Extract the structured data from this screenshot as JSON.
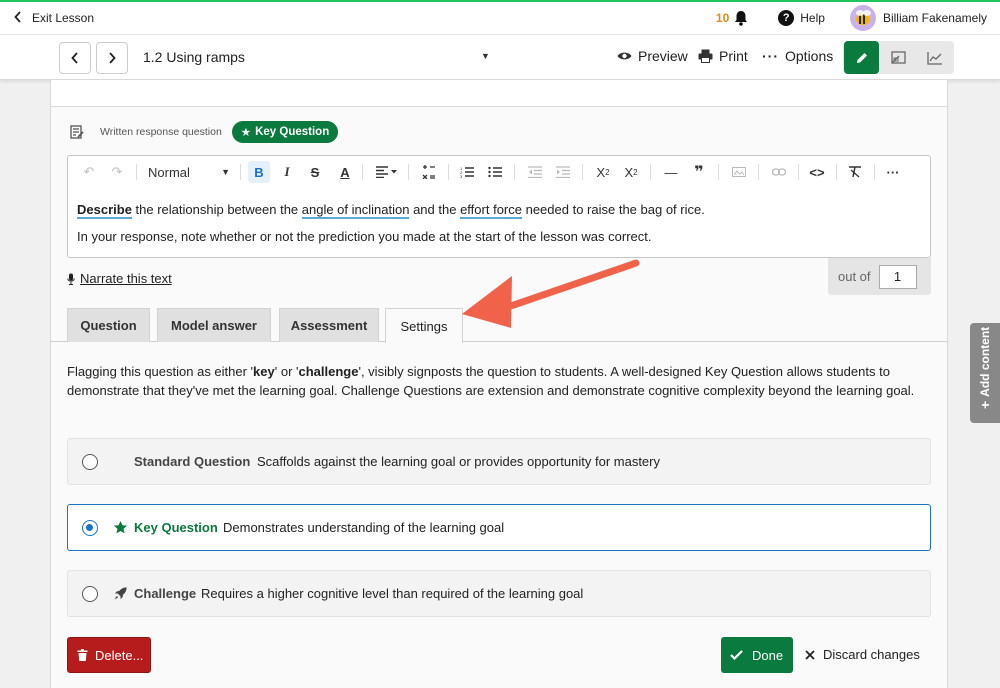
{
  "topbar": {
    "exit_label": "Exit Lesson",
    "notification_count": "10",
    "help_label": "Help",
    "user_name": "Billiam Fakenamely"
  },
  "lessonbar": {
    "title": "1.2 Using ramps",
    "preview_label": "Preview",
    "print_label": "Print",
    "options_label": "Options"
  },
  "question": {
    "type_label": "Written response question",
    "badge_label": "Key Question",
    "toolbar": {
      "style_select": "Normal"
    },
    "body": {
      "line1_kw1": "Describe",
      "line1_t1": " the relationship between the ",
      "line1_kw2": "angle of inclination",
      "line1_t2": " and the ",
      "line1_kw3": "effort force",
      "line1_t3": " needed to raise the bag of rice.",
      "line2": "In your response, note whether or not the prediction you made at the start of the lesson was correct."
    },
    "narrate_label": "Narrate this text",
    "outof_label": "out of",
    "outof_value": "1"
  },
  "tabs": [
    {
      "label": "Question"
    },
    {
      "label": "Model answer"
    },
    {
      "label": "Assessment"
    },
    {
      "label": "Settings"
    }
  ],
  "settings": {
    "desc_t1": "Flagging this question as either '",
    "desc_kw1": "key",
    "desc_t2": "' or '",
    "desc_kw2": "challenge",
    "desc_t3": "', visibly signposts the question to students. A well-designed Key Question allows students to demonstrate that they've met the learning goal. Challenge Questions are extension and demonstrate cognitive complexity beyond the learning goal.",
    "options": [
      {
        "name": "Standard Question",
        "desc": "Scaffolds against the learning goal or provides opportunity for mastery",
        "selected": false
      },
      {
        "name": "Key Question",
        "desc": "Demonstrates understanding of the learning goal",
        "selected": true
      },
      {
        "name": "Challenge",
        "desc": "Requires a higher cognitive level than required of the learning goal",
        "selected": false
      }
    ]
  },
  "actions": {
    "delete_label": "Delete...",
    "done_label": "Done",
    "discard_label": "Discard changes"
  },
  "side": {
    "add_content_label": "Add content"
  },
  "colors": {
    "brand_green": "#0b7a3e",
    "accent_blue": "#1a73c7",
    "danger_red": "#b71c1c",
    "annotation_arrow": "#f0624a"
  }
}
